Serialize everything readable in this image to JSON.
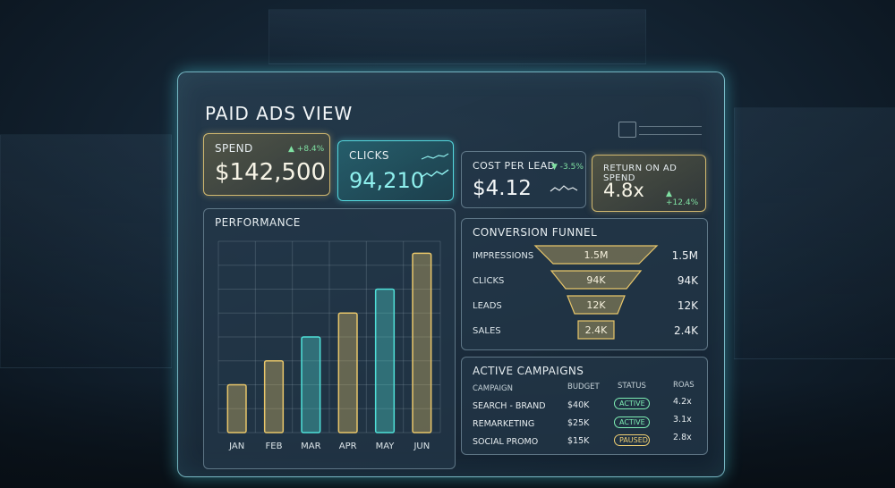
{
  "dashboard": {
    "title": "PAID ADS VIEW"
  },
  "kpis": {
    "spend": {
      "label": "SPEND",
      "value": "$142,500",
      "delta": "+8.4%"
    },
    "clicks": {
      "label": "CLICKS",
      "value": "94,210"
    },
    "cpl": {
      "label": "COST PER LEAD",
      "value": "$4.12",
      "delta": "-3.5%"
    },
    "roas": {
      "label": "RETURN ON AD SPEND",
      "value": "4.8x",
      "delta": "+12.4%"
    }
  },
  "performance": {
    "title": "PERFORMANCE"
  },
  "chart_data": {
    "type": "bar",
    "title": "PERFORMANCE",
    "categories": [
      "JAN",
      "FEB",
      "MAR",
      "APR",
      "MAY",
      "JUN"
    ],
    "values": [
      2,
      3,
      4,
      5,
      6,
      7.5
    ],
    "colors": [
      "gold",
      "gold",
      "teal",
      "gold",
      "teal",
      "gold"
    ],
    "xlabel": "",
    "ylabel": "",
    "ylim": [
      0,
      8
    ],
    "grid": true
  },
  "funnel": {
    "title": "CONVERSION FUNNEL",
    "stages": [
      {
        "label": "IMPRESSIONS",
        "bar_text": "1.5M",
        "value": "1.5M"
      },
      {
        "label": "CLICKS",
        "bar_text": "94K",
        "value": "94K"
      },
      {
        "label": "LEADS",
        "bar_text": "12K",
        "value": "12K"
      },
      {
        "label": "SALES",
        "bar_text": "2.4K",
        "value": "2.4K"
      }
    ]
  },
  "campaigns": {
    "title": "ACTIVE CAMPAIGNS",
    "headers": {
      "campaign": "CAMPAIGN",
      "budget": "BUDGET",
      "status": "STATUS",
      "roas": "ROAS"
    },
    "rows": [
      {
        "campaign": "SEARCH - BRAND",
        "budget": "$40K",
        "status": "ACTIVE",
        "roas": "4.2x"
      },
      {
        "campaign": "REMARKETING",
        "budget": "$25K",
        "status": "ACTIVE",
        "roas": "3.1x"
      },
      {
        "campaign": "SOCIAL PROMO",
        "budget": "$15K",
        "status": "PAUSED",
        "roas": "2.8x"
      }
    ]
  },
  "colors": {
    "gold": "#e8c66a",
    "teal": "#4fe0d8",
    "positive": "#7fe0a2",
    "panel_border": "#96e6f0"
  }
}
